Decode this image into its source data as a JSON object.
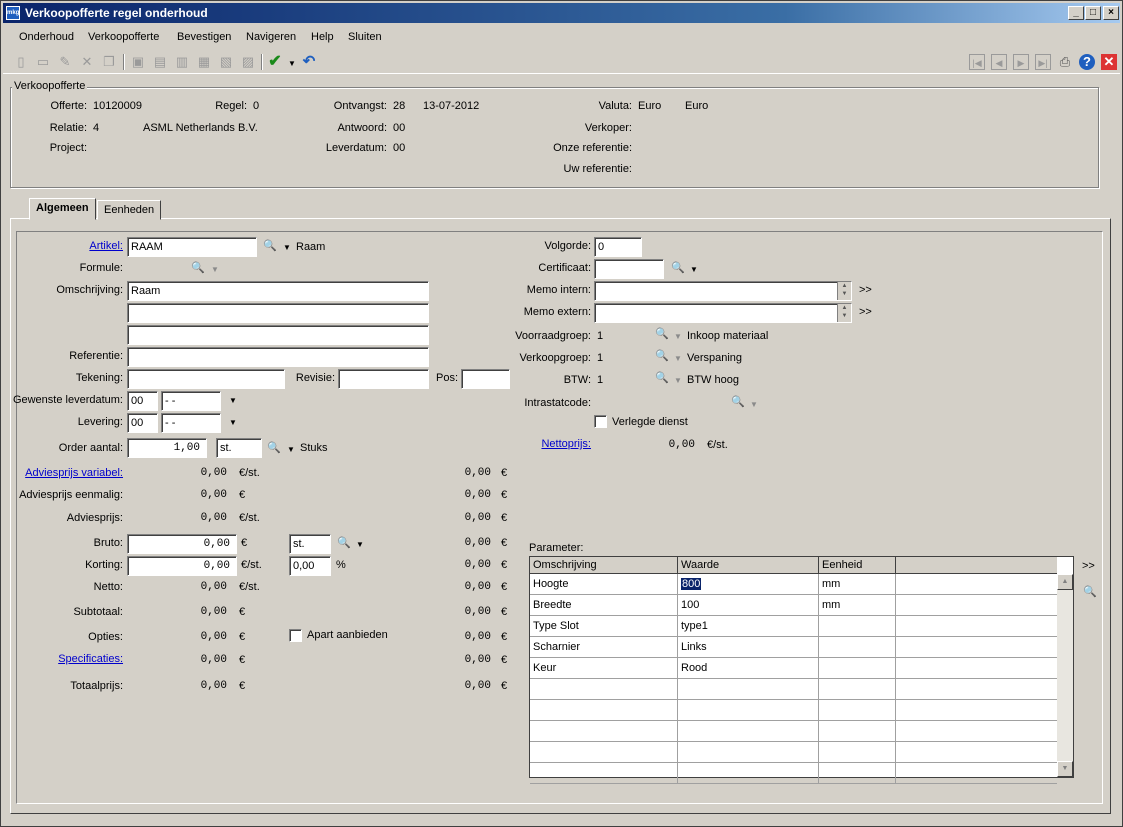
{
  "window": {
    "title": "Verkoopofferte regel onderhoud",
    "icon_text": "mkg"
  },
  "menu": [
    "Onderhoud",
    "Verkoopofferte",
    "Bevestigen",
    "Navigeren",
    "Help",
    "Sluiten"
  ],
  "header_group": {
    "title": "Verkoopofferte",
    "offerte_label": "Offerte:",
    "offerte": "10120009",
    "regel_label": "Regel:",
    "regel": "0",
    "ontvangst_label": "Ontvangst:",
    "ontvangst_week": "28",
    "ontvangst_date": "13-07-2012",
    "valuta_label": "Valuta:",
    "valuta1": "Euro",
    "valuta2": "Euro",
    "relatie_label": "Relatie:",
    "relatie": "4",
    "relatie_name": "ASML Netherlands B.V.",
    "antwoord_label": "Antwoord:",
    "antwoord": "00",
    "verkoper_label": "Verkoper:",
    "project_label": "Project:",
    "leverdatum_label": "Leverdatum:",
    "leverdatum": "00",
    "onze_ref_label": "Onze referentie:",
    "uw_ref_label": "Uw referentie:"
  },
  "tabs": [
    {
      "label": "Algemeen"
    },
    {
      "label": "Eenheden"
    }
  ],
  "form": {
    "artikel_label": "Artikel:",
    "artikel": "RAAM",
    "artikel_desc": "Raam",
    "formule_label": "Formule:",
    "omschrijving_label": "Omschrijving:",
    "omschrijving1": "Raam",
    "omschrijving2": "",
    "omschrijving3": "",
    "referentie_label": "Referentie:",
    "referentie": "",
    "tekening_label": "Tekening:",
    "tekening": "",
    "revisie_label": "Revisie:",
    "revisie": "",
    "pos_label": "Pos:",
    "pos": "",
    "gewenste_label": "Gewenste leverdatum:",
    "gewenste_week": "00",
    "gewenste_date": " - - ",
    "levering_label": "Levering:",
    "levering_week": "00",
    "levering_date": " - - ",
    "order_label": "Order aantal:",
    "order_aantal": "1,00",
    "order_unit": "st.",
    "order_unit_desc": "Stuks",
    "volgorde_label": "Volgorde:",
    "volgorde": "0",
    "certificaat_label": "Certificaat:",
    "certificaat": "",
    "memo_intern_label": "Memo intern:",
    "memo_extern_label": "Memo extern:",
    "more": ">>",
    "voorraadgroep_label": "Voorraadgroep:",
    "voorraadgroep": "1",
    "voorraadgroep_desc": "Inkoop materiaal",
    "verkoopgroep_label": "Verkoopgroep:",
    "verkoopgroep": "1",
    "verkoopgroep_desc": "Verspaning",
    "btw_label": "BTW:",
    "btw": "1",
    "btw_desc": "BTW hoog",
    "intrastat_label": "Intrastatcode:",
    "verlegde_label": "Verlegde dienst",
    "nettoprijs_label": "Nettoprijs:",
    "nettoprijs": "0,00",
    "nettoprijs_unit": "€/st."
  },
  "prices": [
    {
      "label": "Adviesprijs variabel:",
      "link": true,
      "value": "0,00",
      "unit": "€/st.",
      "total": "0,00",
      "cur": "€"
    },
    {
      "label": "Adviesprijs eenmalig:",
      "link": false,
      "value": "0,00",
      "unit": "€",
      "total": "0,00",
      "cur": "€"
    },
    {
      "label": "Adviesprijs:",
      "link": false,
      "value": "0,00",
      "unit": "€/st.",
      "total": "0,00",
      "cur": "€"
    }
  ],
  "calc": {
    "bruto_label": "Bruto:",
    "bruto": "0,00",
    "bruto_unit": "€",
    "bruto_uom": "st.",
    "bruto_total": "0,00",
    "korting_label": "Korting:",
    "korting": "0,00",
    "korting_unit": "€/st.",
    "korting_pct": "0,00",
    "pct": "%",
    "korting_total": "0,00",
    "netto_label": "Netto:",
    "netto": "0,00",
    "netto_unit": "€/st.",
    "netto_total": "0,00",
    "subtotaal_label": "Subtotaal:",
    "subtotaal": "0,00",
    "subtotaal_unit": "€",
    "subtotaal_total": "0,00",
    "opties_label": "Opties:",
    "opties": "0,00",
    "opties_unit": "€",
    "opties_total": "0,00",
    "apart_label": "Apart aanbieden",
    "specificaties_label": "Specificaties:",
    "specificaties": "0,00",
    "specificaties_unit": "€",
    "specificaties_total": "0,00",
    "totaalprijs_label": "Totaalprijs:",
    "totaalprijs": "0,00",
    "totaalprijs_unit": "€",
    "totaalprijs_total": "0,00",
    "cur": "€"
  },
  "parameter": {
    "label": "Parameter:",
    "columns": [
      "Omschrijving",
      "Waarde",
      "Eenheid"
    ],
    "rows": [
      {
        "omschrijving": "Hoogte",
        "waarde": "800",
        "eenheid": "mm"
      },
      {
        "omschrijving": "Breedte",
        "waarde": "100",
        "eenheid": "mm"
      },
      {
        "omschrijving": "Type Slot",
        "waarde": "type1",
        "eenheid": ""
      },
      {
        "omschrijving": "Scharnier",
        "waarde": "Links",
        "eenheid": ""
      },
      {
        "omschrijving": "Keur",
        "waarde": "Rood",
        "eenheid": ""
      }
    ],
    "more": ">>"
  }
}
